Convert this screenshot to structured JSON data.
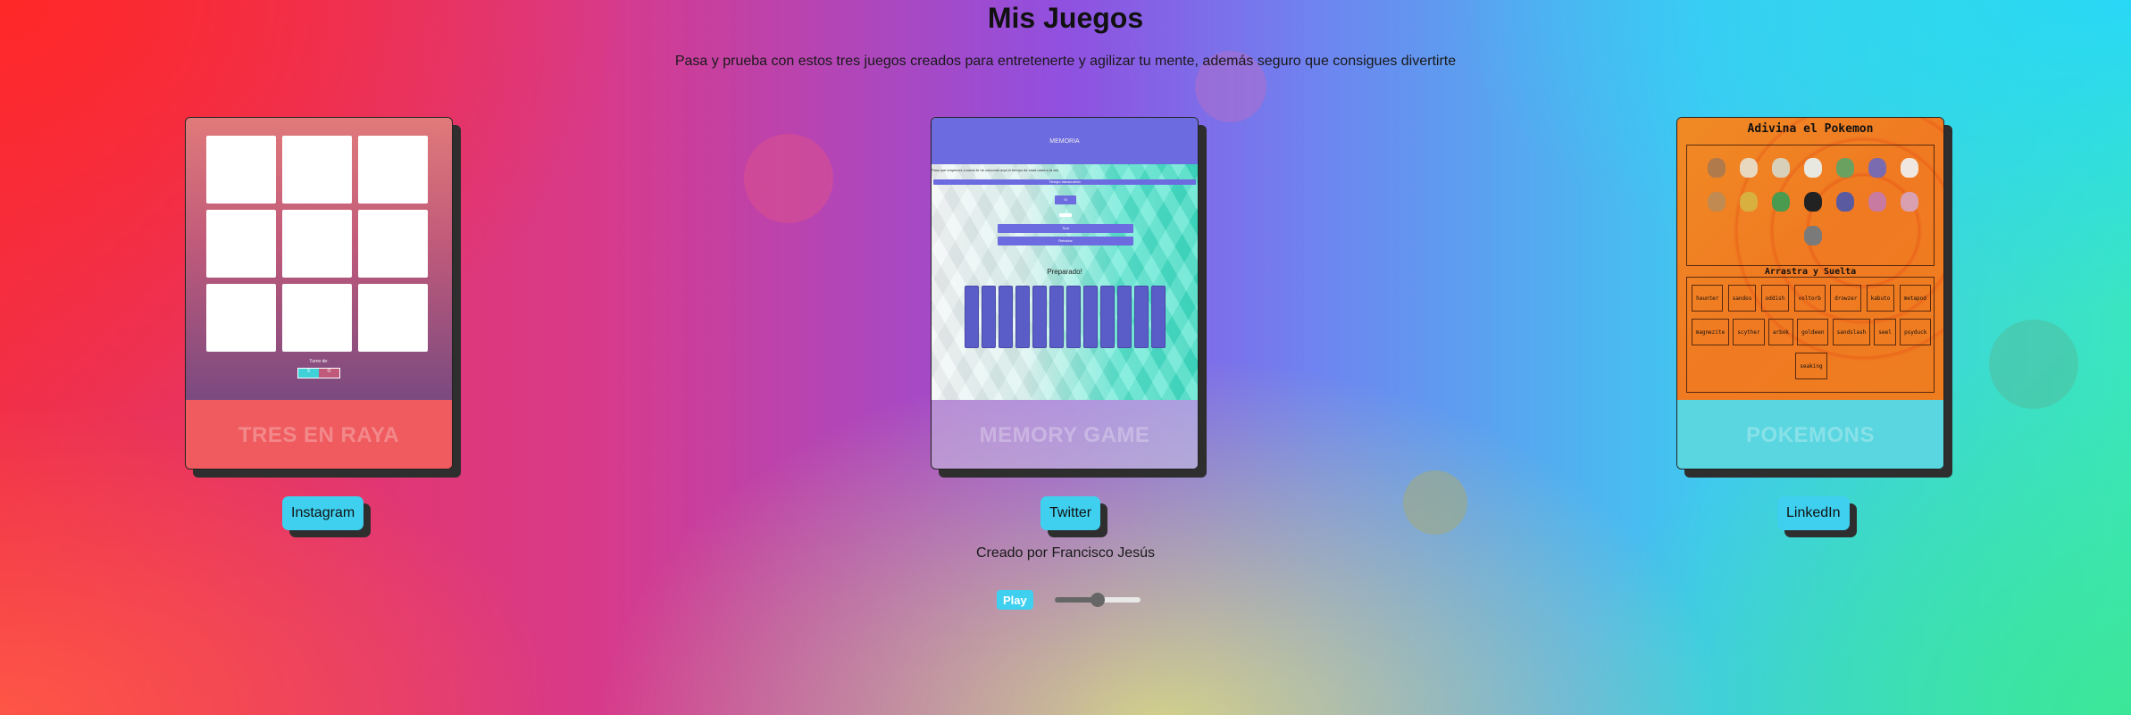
{
  "page": {
    "title": "Mis Juegos",
    "subtitle": "Pasa y prueba con estos tres juegos creados para entretenerte y agilizar tu mente, además seguro que consigues divertirte",
    "credit": "Creado por Francisco Jesús"
  },
  "cards": [
    {
      "label": "TRES EN RAYA",
      "preview": {
        "turn_text": "Turno de:",
        "score_left": "X",
        "score_right": "O"
      }
    },
    {
      "label": "MEMORY GAME",
      "preview": {
        "header": "MEMORIA",
        "line1": "Para que empieces a sonar te he colocado aqui el tiempo de cada carta a la vez",
        "bar_text": "Tiempo transcurrido",
        "button1": "Si",
        "button2": "Tirar",
        "button3": "Reiniciar",
        "ready_text": "Preparado!"
      }
    },
    {
      "label": "POKEMONS",
      "preview": {
        "title": "Adivina el Pokemon",
        "subtitle": "Arrastra y Suelta",
        "words": [
          "haunter",
          "sandos",
          "oddish",
          "voltorb",
          "drowzer",
          "kabuto",
          "metapod",
          "magnezite",
          "scyther",
          "arbok",
          "goldeen",
          "sandslash",
          "seel",
          "psyduck",
          "seaking"
        ]
      }
    }
  ],
  "social": {
    "instagram": "Instagram",
    "twitter": "Twitter",
    "linkedin": "LinkedIn"
  },
  "player": {
    "play_label": "Play",
    "volume": 0.5
  }
}
